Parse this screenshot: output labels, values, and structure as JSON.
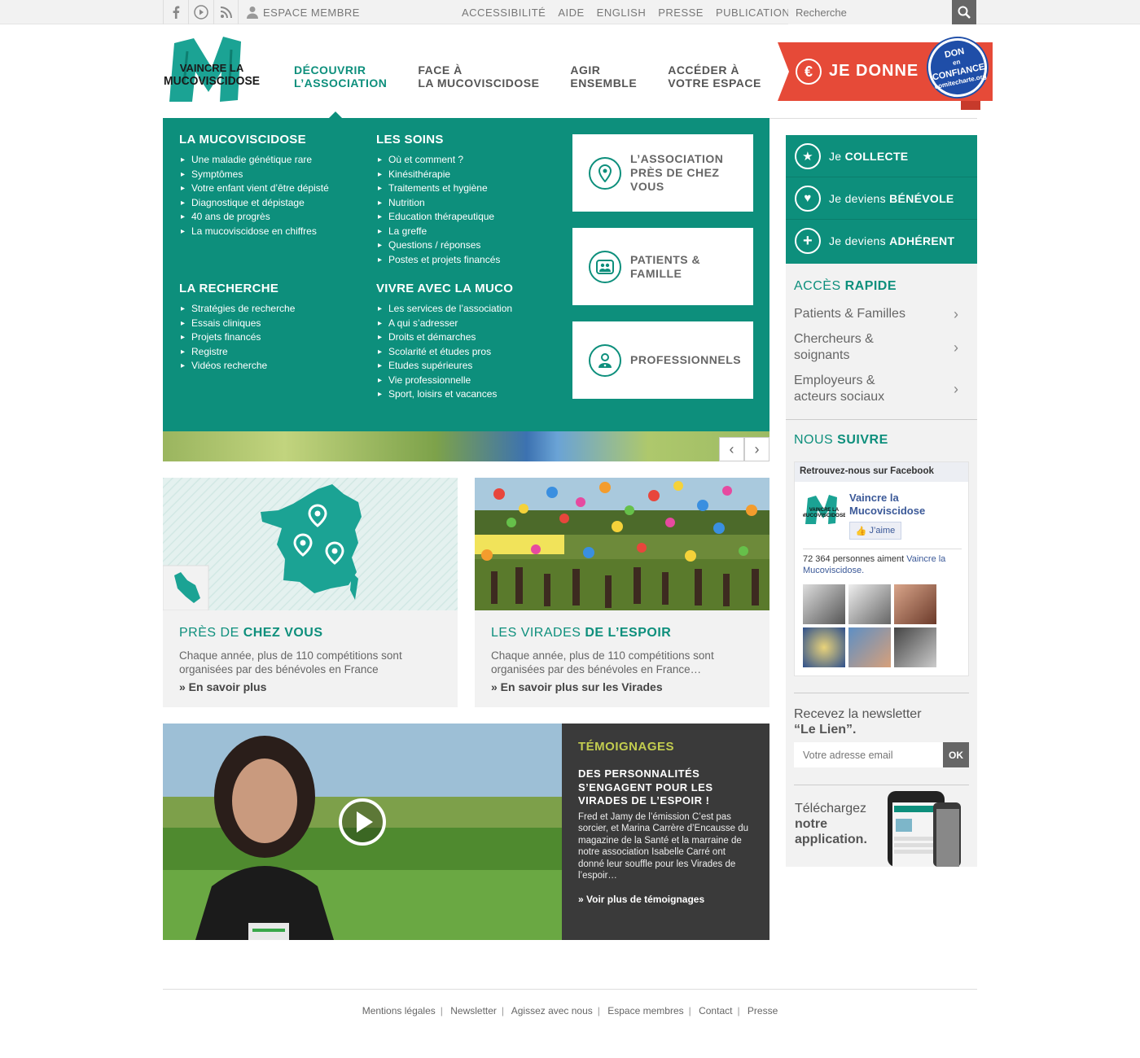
{
  "topbar": {
    "social_icons": [
      "facebook-icon",
      "youtube-icon",
      "rss-icon"
    ],
    "member_label": "ESPACE MEMBRE",
    "links": [
      "ACCESSIBILITÉ",
      "AIDE",
      "ENGLISH",
      "PRESSE",
      "PUBLICATIONS"
    ],
    "search_placeholder": "Recherche"
  },
  "logo": {
    "line1": "VAINCRE LA",
    "line2": "MUCOVISCIDOSE"
  },
  "nav": {
    "items": [
      {
        "line1": "DÉCOUVRIR",
        "line2": "L’ASSOCIATION",
        "active": true
      },
      {
        "line1": "FACE À",
        "line2": "LA MUCOVISCIDOSE",
        "active": false
      },
      {
        "line1": "AGIR",
        "line2": "ENSEMBLE",
        "active": false
      },
      {
        "line1": "ACCÉDER À",
        "line2": "VOTRE ESPACE",
        "active": false
      }
    ]
  },
  "donate": {
    "label": "JE DONNE",
    "badge_line1": "DON",
    "badge_line2": "en",
    "badge_line3": "CONFIANCE",
    "badge_line4": "comitecharte.org"
  },
  "megamenu": {
    "col1": {
      "title": "LA MUCOVISCIDOSE",
      "items": [
        "Une maladie génétique rare",
        "Symptômes",
        "Votre enfant vient d’être dépisté",
        "Diagnostique et dépistage",
        "40 ans de progrès",
        "La mucoviscidose en chiffres"
      ]
    },
    "col2": {
      "title": "LES SOINS",
      "items": [
        "Où et comment ?",
        "Kinésithérapie",
        "Traitements et hygiène",
        "Nutrition",
        "Education thérapeutique",
        "La greffe",
        "Questions / réponses",
        "Postes et projets financés"
      ]
    },
    "col3": {
      "title": "LA RECHERCHE",
      "items": [
        "Stratégies de recherche",
        "Essais cliniques",
        "Projets financés",
        "Registre",
        "Vidéos recherche"
      ]
    },
    "col4": {
      "title": "VIVRE AVEC LA MUCO",
      "items": [
        "Les services de l’association",
        "A qui s’adresser",
        "Droits et démarches",
        "Scolarité et études pros",
        "Etudes supérieures",
        "Vie professionnelle",
        "Sport, loisirs et vacances"
      ]
    },
    "boxes": [
      {
        "line1": "L’ASSOCIATION",
        "line2": "PRÈS DE CHEZ",
        "line3": "VOUS"
      },
      {
        "line1": "PATIENTS &",
        "line2": "FAMILLE"
      },
      {
        "line1": "PROFESSIONNELS"
      }
    ]
  },
  "cards": [
    {
      "title_light": "PRÈS DE ",
      "title_bold": "CHEZ VOUS",
      "text": "Chaque année, plus de 110 compétitions sont organisées par des bénévoles en France",
      "more": "» En savoir plus"
    },
    {
      "title_light": "LES VIRADES ",
      "title_bold": "DE L’ESPOIR",
      "text": "Chaque année, plus de 110 compétitions sont organisées par des bénévoles en France…",
      "more": "» En savoir plus sur les Virades"
    }
  ],
  "testimony": {
    "kicker": "TÉMOIGNAGES",
    "headline": "DES PERSONNALITÉS S’ENGAGENT POUR LES VIRADES DE L’ESPOIR !",
    "body": "Fred et Jamy de l’émission C’est pas sorcier, et Marina Carrère d’Encausse du magazine de la Santé et la marraine de notre association Isabelle Carré ont donné leur souffle pour les Virades de l’espoir…",
    "more": "» Voir plus de témoignages"
  },
  "sidebar": {
    "actions": [
      {
        "prefix": "Je ",
        "bold": "COLLECTE",
        "icon": "star-icon"
      },
      {
        "prefix": "Je deviens ",
        "bold": "BÉNÉVOLE",
        "icon": "heart-icon"
      },
      {
        "prefix": "Je deviens ",
        "bold": "ADHÉRENT",
        "icon": "plus-icon"
      }
    ],
    "quick_title_light": "ACCÈS ",
    "quick_title_bold": "RAPIDE",
    "quick_links": [
      {
        "line1": "Patients & Familles",
        "line2": ""
      },
      {
        "line1": "Chercheurs &",
        "line2": "soignants"
      },
      {
        "line1": "Employeurs &",
        "line2": "acteurs sociaux"
      }
    ],
    "follow_title_light": "NOUS ",
    "follow_title_bold": "SUIVRE",
    "facebook": {
      "header": "Retrouvez-nous sur Facebook",
      "page_name": "Vaincre la Mucoviscidose",
      "like_label": "J’aime",
      "count_text": "72 364 personnes aiment ",
      "count_link": "Vaincre la Mucoviscidose."
    },
    "newsletter_line1": "Recevez la newsletter",
    "newsletter_line2": "“Le Lien”.",
    "email_placeholder": "Votre adresse email",
    "ok_label": "OK",
    "app_line1": "Téléchargez",
    "app_line2": "notre",
    "app_line3": "application."
  },
  "footer": {
    "links": [
      "Mentions légales",
      "Newsletter",
      "Agissez avec nous",
      "Espace membres",
      "Contact",
      "Presse"
    ]
  },
  "colors": {
    "brand_green": "#0d8f7c",
    "donate_red": "#e64a38",
    "dark_panel": "#3a3a3a",
    "accent_lime": "#c3cd4f"
  }
}
